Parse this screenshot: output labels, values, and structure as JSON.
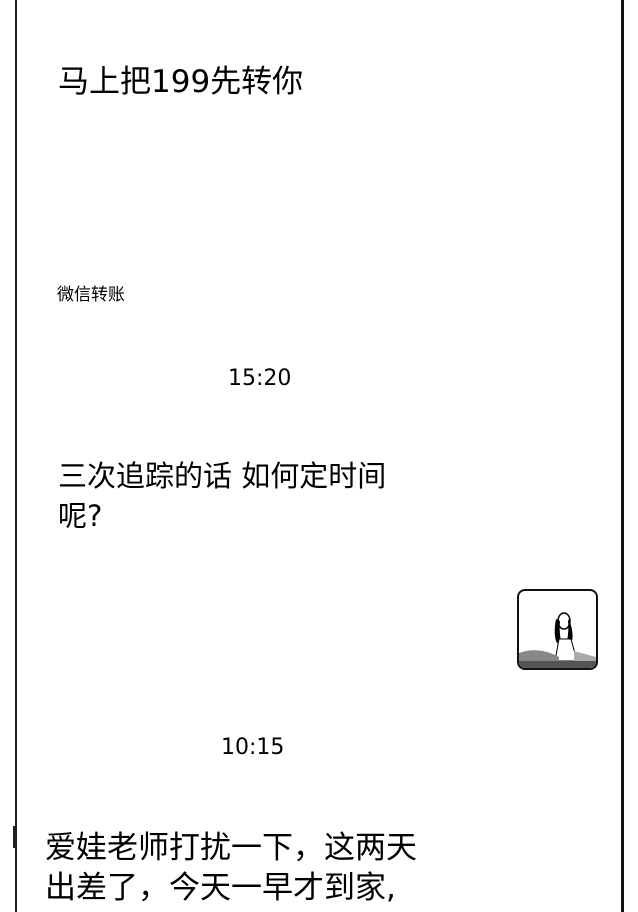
{
  "messages": [
    {
      "text": "马上把199先转你",
      "subtitle": "微信转账"
    },
    {
      "time": "15:20"
    },
    {
      "lines": [
        "三次追踪的话 如何定时间",
        "呢?"
      ]
    },
    {
      "time": "10:15"
    },
    {
      "lines": [
        "爱娃老师打扰一下，这两天",
        "出差了，今天一早才到家,"
      ]
    }
  ]
}
